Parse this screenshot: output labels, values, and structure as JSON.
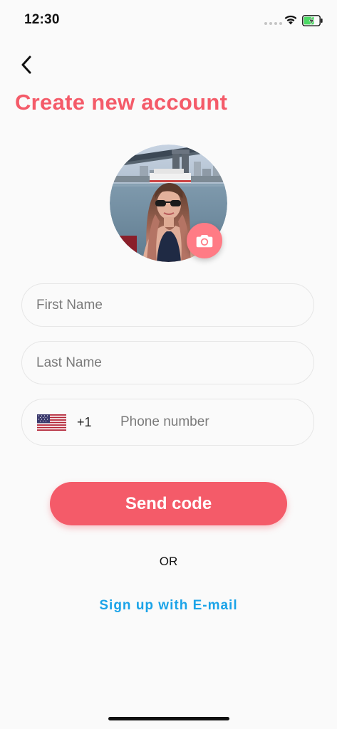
{
  "status_bar": {
    "time": "12:30",
    "wifi_icon": "wifi-icon",
    "battery_icon": "battery-charging-icon",
    "battery_color": "#4cd964"
  },
  "navigation": {
    "back_icon": "chevron-left-icon"
  },
  "header": {
    "title": "Create new account"
  },
  "profile": {
    "camera_icon": "camera-icon",
    "camera_color": "#ff7b85"
  },
  "form": {
    "first_name": {
      "placeholder": "First Name",
      "value": ""
    },
    "last_name": {
      "placeholder": "Last Name",
      "value": ""
    },
    "phone": {
      "flag_icon": "us-flag-icon",
      "country_code": "+1",
      "placeholder": "Phone number",
      "value": ""
    }
  },
  "actions": {
    "send_code_label": "Send code",
    "or_label": "OR",
    "email_signup_label": "Sign up with E-mail"
  },
  "colors": {
    "accent": "#f45b69",
    "link": "#1aa3e8",
    "background": "#fafafa"
  }
}
